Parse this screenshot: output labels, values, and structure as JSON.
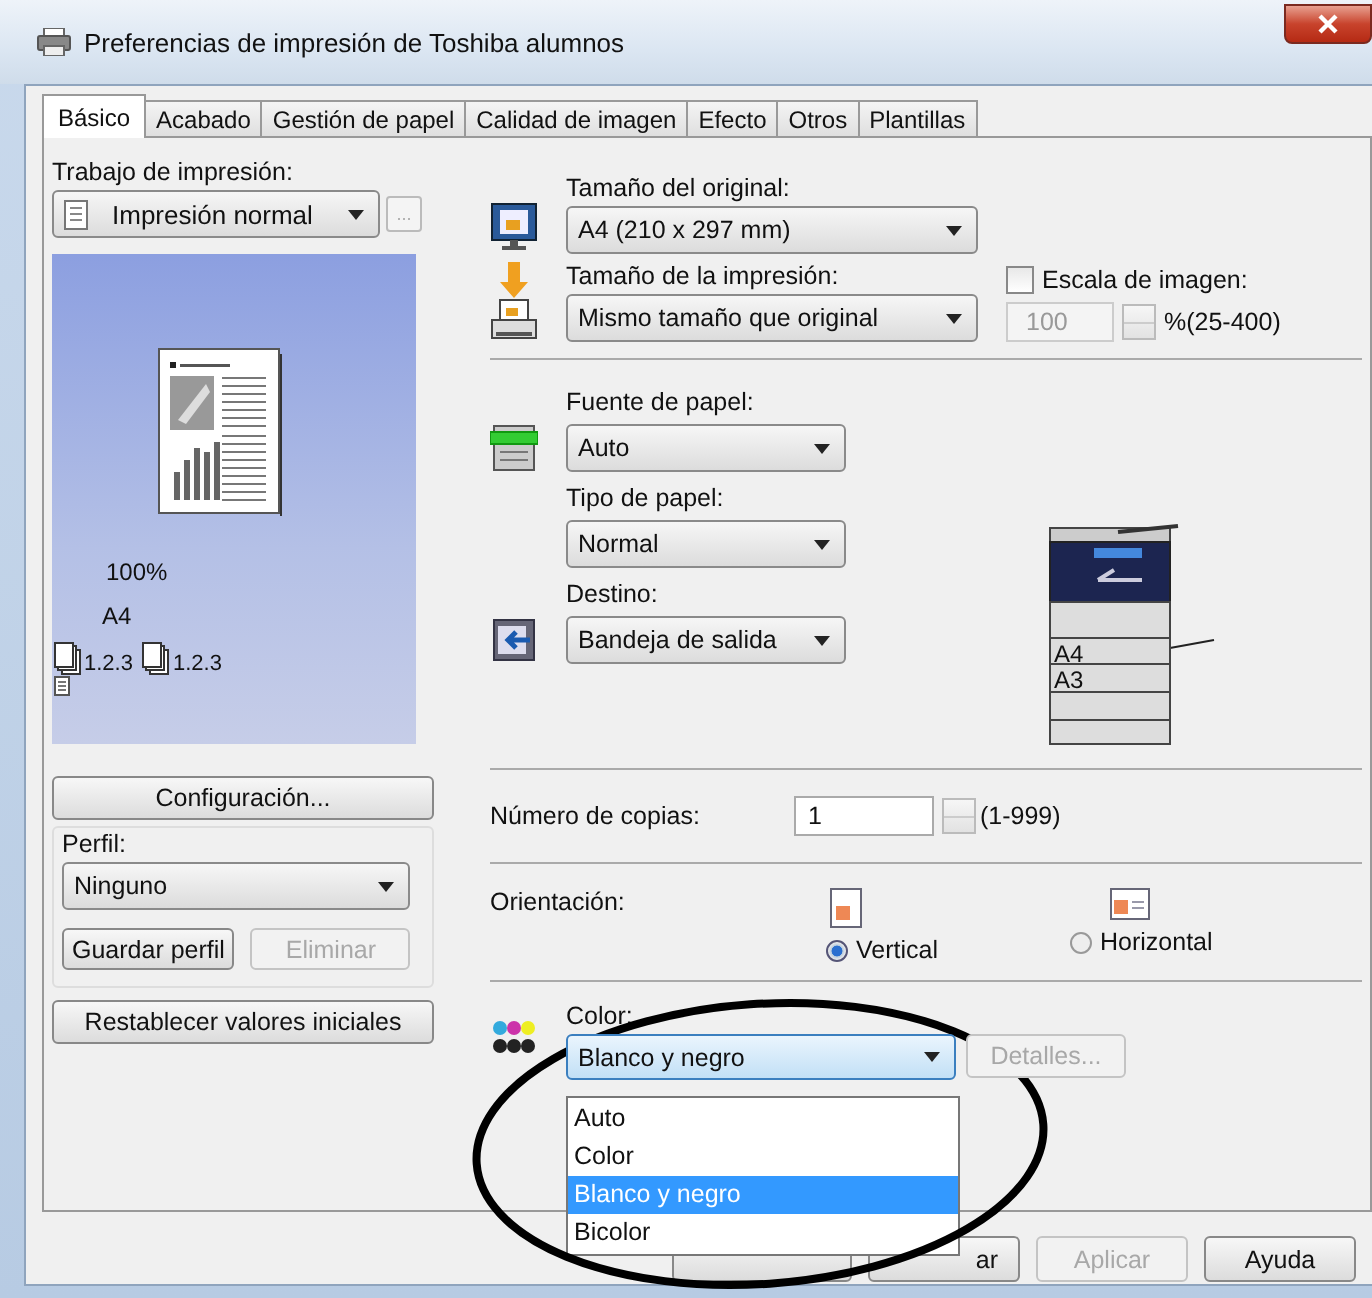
{
  "window": {
    "title": "Preferencias de impresión de Toshiba alumnos"
  },
  "tabs": [
    {
      "label": "Básico",
      "selected": true
    },
    {
      "label": "Acabado",
      "selected": false
    },
    {
      "label": "Gestión de papel",
      "selected": false
    },
    {
      "label": "Calidad de imagen",
      "selected": false
    },
    {
      "label": "Efecto",
      "selected": false
    },
    {
      "label": "Otros",
      "selected": false
    },
    {
      "label": "Plantillas",
      "selected": false
    }
  ],
  "print_job": {
    "label": "Trabajo de impresión:",
    "value": "Impresión normal",
    "more_button": "..."
  },
  "preview": {
    "zoom": "100%",
    "paper": "A4",
    "collate_labels": [
      "1.2.3",
      "1.2.3"
    ]
  },
  "config_button": "Configuración...",
  "profile": {
    "label": "Perfil:",
    "value": "Ninguno",
    "save_button": {
      "label": "Guardar perfil",
      "disabled": false
    },
    "delete_button": {
      "label": "Eliminar",
      "disabled": true
    }
  },
  "reset_button": "Restablecer valores iniciales",
  "original_size": {
    "label": "Tamaño del original:",
    "value": "A4 (210 x 297 mm)"
  },
  "print_size": {
    "label": "Tamaño de la impresión:",
    "value": "Mismo tamaño que original"
  },
  "image_scale": {
    "label": "Escala de imagen:",
    "checked": false,
    "value": "100",
    "range": "%(25-400)"
  },
  "paper_source": {
    "label": "Fuente de papel:",
    "value": "Auto"
  },
  "paper_type": {
    "label": "Tipo de papel:",
    "value": "Normal"
  },
  "destination": {
    "label": "Destino:",
    "value": "Bandeja de salida"
  },
  "printer_trays": [
    "A4",
    "A3"
  ],
  "copies": {
    "label": "Número de copias:",
    "value": "1",
    "range": "(1-999)"
  },
  "orientation": {
    "label": "Orientación:",
    "options": [
      {
        "label": "Vertical",
        "selected": true
      },
      {
        "label": "Horizontal",
        "selected": false
      }
    ]
  },
  "color": {
    "label": "Color:",
    "value": "Blanco y negro",
    "details_button": {
      "label": "Detalles...",
      "disabled": true
    },
    "options": [
      {
        "label": "Auto",
        "selected": false
      },
      {
        "label": "Color",
        "selected": false
      },
      {
        "label": "Blanco y negro",
        "selected": true
      },
      {
        "label": "Bicolor",
        "selected": false
      }
    ]
  },
  "buttons": [
    {
      "label": "ar",
      "disabled": false
    },
    {
      "label": "Aplicar",
      "disabled": true
    },
    {
      "label": "Ayuda",
      "disabled": false
    }
  ]
}
